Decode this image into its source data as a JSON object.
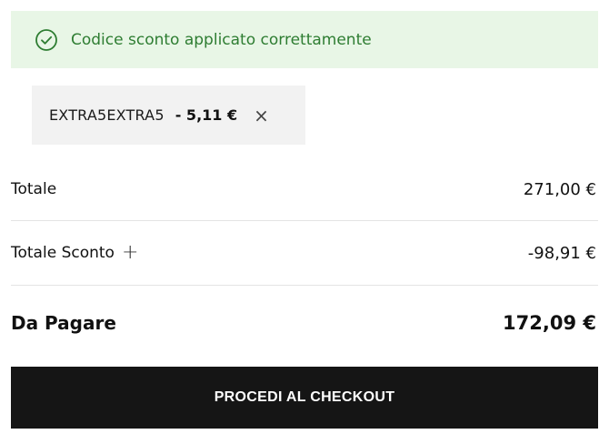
{
  "alert": {
    "icon": "check-circle-icon",
    "message": "Codice sconto applicato correttamente",
    "color": "#2e7d32",
    "background": "#e8f6e6"
  },
  "coupon": {
    "code": "EXTRA5EXTRA5",
    "amount": "- 5,11 €",
    "remove_symbol": "×",
    "remove_icon": "close-icon"
  },
  "summary": {
    "total_label": "Totale",
    "total_value": "271,00 €",
    "discount_label": "Totale Sconto",
    "discount_toggle": "+",
    "discount_value": "-98,91 €",
    "pay_label": "Da Pagare",
    "pay_value": "172,09 €"
  },
  "checkout": {
    "label": "PROCEDI AL CHECKOUT",
    "background": "#151515"
  }
}
